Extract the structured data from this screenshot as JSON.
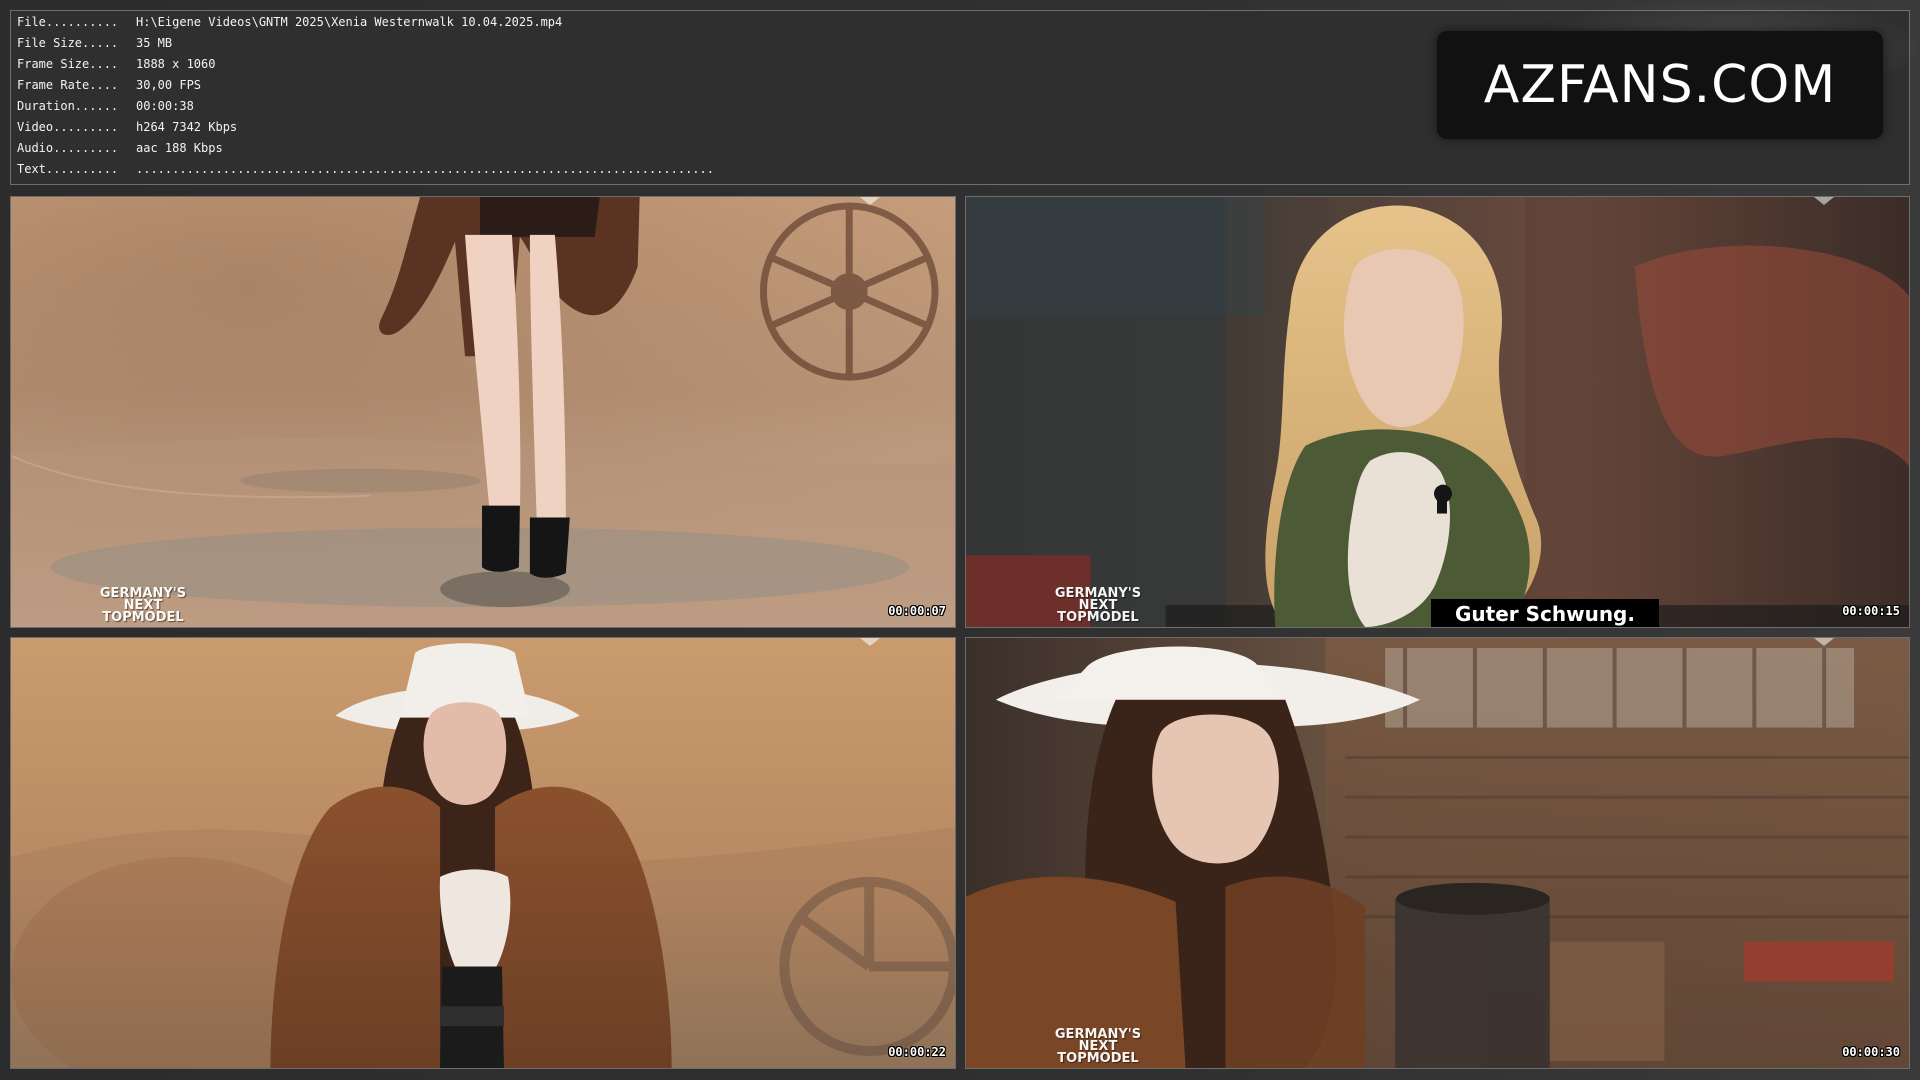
{
  "header": {
    "rows": [
      {
        "key": "File..........",
        "value": "H:\\Eigene Videos\\GNTM 2025\\Xenia Westernwalk 10.04.2025.mp4"
      },
      {
        "key": "File Size.....",
        "value": "35 MB"
      },
      {
        "key": "Frame Size....",
        "value": "1888 x 1060"
      },
      {
        "key": "Frame Rate....",
        "value": "30,00 FPS"
      },
      {
        "key": "Duration......",
        "value": "00:00:38"
      },
      {
        "key": "Video.........",
        "value": "h264 7342 Kbps"
      },
      {
        "key": "Audio.........",
        "value": "aac 188 Kbps"
      },
      {
        "key": "Text..........",
        "value": "................................................................................"
      }
    ]
  },
  "watermark": {
    "text": "AZFANS.COM",
    "bg_color": "#111111",
    "text_color": "#ffffff"
  },
  "thumbnails": [
    {
      "timestamp": "00:00:07",
      "logo_text": "GERMANY'S\nNEXT\nTOPMODEL",
      "subtitle": ""
    },
    {
      "timestamp": "00:00:15",
      "logo_text": "GERMANY'S\nNEXT\nTOPMODEL",
      "subtitle": "Guter Schwung."
    },
    {
      "timestamp": "00:00:22",
      "logo_text": "",
      "subtitle": ""
    },
    {
      "timestamp": "00:00:30",
      "logo_text": "GERMANY'S\nNEXT\nTOPMODEL",
      "subtitle": ""
    }
  ],
  "colors": {
    "panel_bg": "#2f2f2f",
    "panel_border": "#6f6f6f",
    "page_bg": "#2b2b2b"
  }
}
